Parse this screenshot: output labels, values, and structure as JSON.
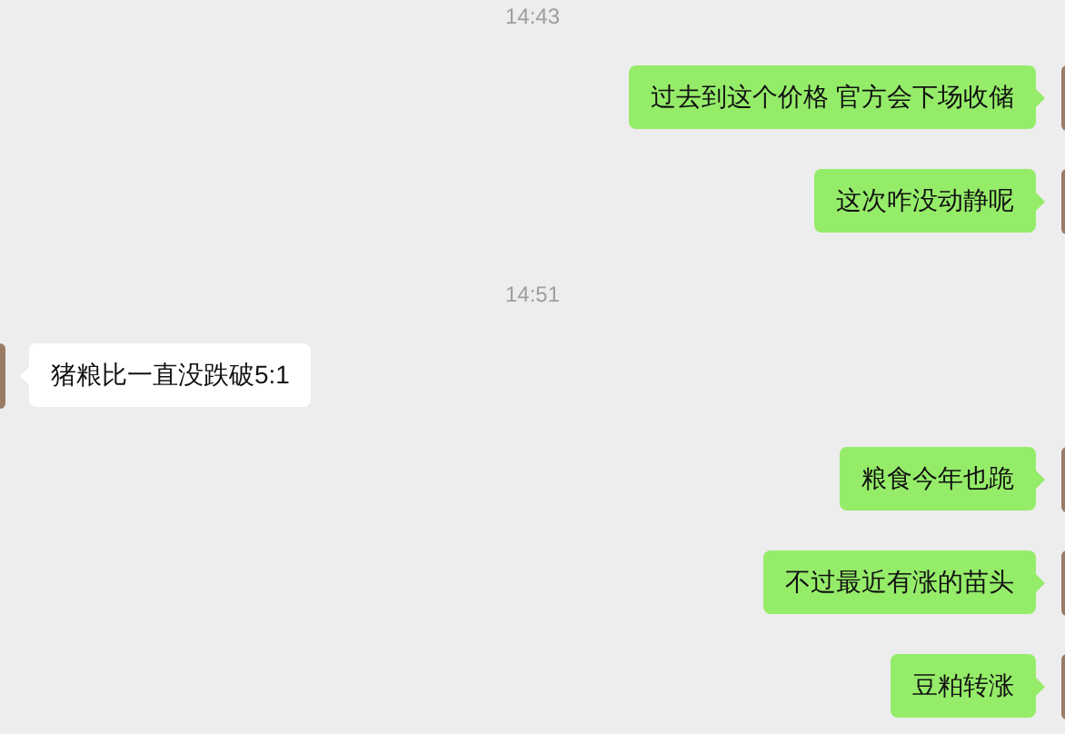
{
  "messages": [
    {
      "kind": "time",
      "text": "14:43"
    },
    {
      "kind": "sent",
      "text": "过去到这个价格 官方会下场收储"
    },
    {
      "kind": "sent",
      "text": "这次咋没动静呢"
    },
    {
      "kind": "time",
      "text": "14:51"
    },
    {
      "kind": "received",
      "text": "猪粮比一直没跌破5:1"
    },
    {
      "kind": "sent",
      "text": "粮食今年也跪"
    },
    {
      "kind": "sent",
      "text": "不过最近有涨的苗头"
    },
    {
      "kind": "sent",
      "text": "豆粕转涨"
    }
  ]
}
